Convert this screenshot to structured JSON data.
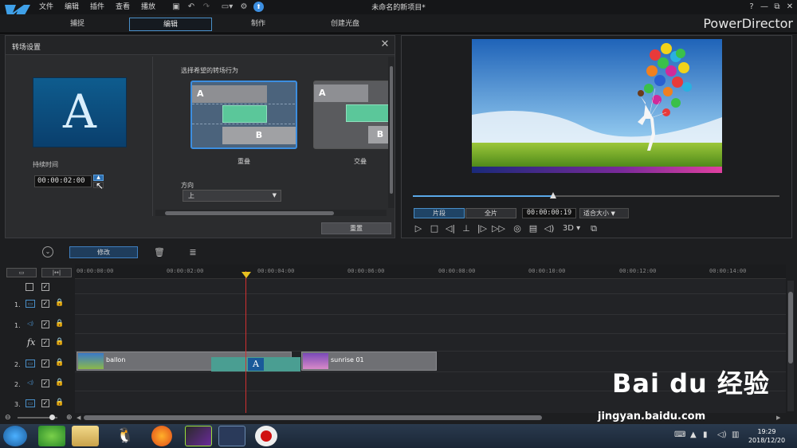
{
  "menu": [
    "文件",
    "编辑",
    "插件",
    "查看",
    "播放"
  ],
  "window_title": "未命名的新项目*",
  "window_controls": [
    "?",
    "—",
    "⧉",
    "✕"
  ],
  "mode_tabs": [
    "捕捉",
    "编辑",
    "制作",
    "创建光盘"
  ],
  "active_mode": "编辑",
  "brand": "PowerDirector",
  "transition_panel": {
    "title": "转场设置",
    "preview_letter": "A",
    "duration_label": "持续时间",
    "duration_value": "00:00:02:00",
    "behavior_label": "选择希望的转场行为",
    "options": [
      {
        "name": "重叠",
        "selected": true,
        "a": "A",
        "b": "B"
      },
      {
        "name": "交叠",
        "selected": false,
        "a": "A",
        "b": "B"
      }
    ],
    "direction_label": "方向",
    "direction_value": "上",
    "reset_label": "重置"
  },
  "player": {
    "mode_clip": "片段",
    "mode_full": "全片",
    "timecode": "00:00:00:19",
    "fit_label": "适合大小",
    "three_d": "3D",
    "progress": 0.38
  },
  "toolbar": {
    "edit_label": "修改"
  },
  "timeline": {
    "ticks": [
      "00:00:00:00",
      "00:00:02:00",
      "00:00:04:00",
      "00:00:06:00",
      "00:00:08:00",
      "00:00:10:00",
      "00:00:12:00",
      "00:00:14:00"
    ],
    "track_numbers": [
      "1.",
      "1.",
      "2.",
      "2.",
      "3."
    ],
    "fx_label": "fx",
    "clips": [
      {
        "name": "ballon"
      },
      {
        "name": "sunrise 01"
      }
    ],
    "transition_letter": "A"
  },
  "taskbar": {
    "time": "19:29",
    "date": "2018/12/20"
  },
  "watermark": {
    "logo_text": "Bai du 经验",
    "url": "jingyan.baidu.com"
  }
}
